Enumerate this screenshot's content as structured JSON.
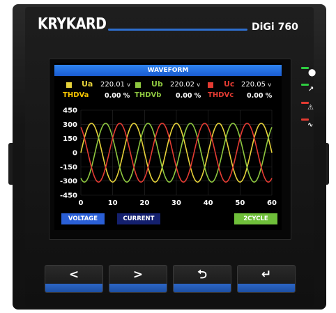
{
  "device": {
    "brand": "KRYKARD",
    "model": "DiGi 760"
  },
  "screen": {
    "title": "WAVEFORM",
    "phases": [
      {
        "label": "Ua",
        "value": "220.01",
        "unit": "v",
        "color": "#e6d23a"
      },
      {
        "label": "Ub",
        "value": "220.02",
        "unit": "v",
        "color": "#8dc63f"
      },
      {
        "label": "Uc",
        "value": "220.05",
        "unit": "v",
        "color": "#e33b32"
      }
    ],
    "thd": [
      {
        "label": "THDVa",
        "value": "0.00 %",
        "color": "#f5c400"
      },
      {
        "label": "THDVb",
        "value": "0.00 %",
        "color": "#8dc63f"
      },
      {
        "label": "THDVc",
        "value": "0.00 %",
        "color": "#e33b32"
      }
    ],
    "softkeys": {
      "voltage": "VOLTAGE",
      "current": "CURRENT",
      "cycle": "2CYCLE"
    }
  },
  "chart_data": {
    "type": "line",
    "ylim": [
      -450,
      450
    ],
    "xlim": [
      0,
      60
    ],
    "yticks": [
      "450",
      "300",
      "150",
      "0",
      "-150",
      "-300",
      "-450"
    ],
    "xticks": [
      "0",
      "10",
      "20",
      "30",
      "40",
      "50",
      "60"
    ],
    "grid": true,
    "samples": 2,
    "amplitude": 311,
    "series": [
      {
        "name": "Ua",
        "phase_deg": 0,
        "color": "#e6d23a"
      },
      {
        "name": "Ub",
        "phase_deg": -120,
        "color": "#8dc63f"
      },
      {
        "name": "Uc",
        "phase_deg": 120,
        "color": "#e33b32"
      }
    ],
    "cycles_shown": 4.5
  },
  "keys": [
    {
      "name": "left",
      "glyph": "<"
    },
    {
      "name": "right",
      "glyph": ">"
    },
    {
      "name": "back",
      "glyph": "⮌"
    },
    {
      "name": "enter",
      "glyph": "↵"
    }
  ],
  "indicators": [
    {
      "name": "run",
      "led": "#2ecc40",
      "icon": "⬤"
    },
    {
      "name": "comm",
      "led": "#2ecc40",
      "icon": "↗"
    },
    {
      "name": "alarm",
      "led": "#e33b32",
      "icon": "⚠"
    },
    {
      "name": "fault",
      "led": "#e33b32",
      "icon": "∿"
    }
  ]
}
